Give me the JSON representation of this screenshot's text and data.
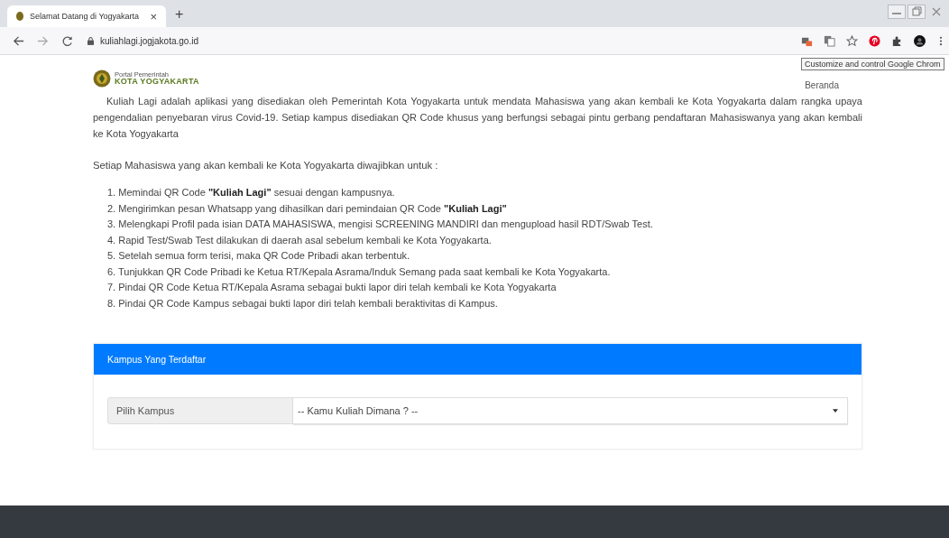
{
  "browser": {
    "tab_title": "Selamat Datang di Yogyakarta",
    "tab_close": "×",
    "new_tab": "+",
    "url": "kuliahlagi.jogjakota.go.id",
    "tooltip": "Customize and control Google Chrom"
  },
  "header": {
    "logo_top": "Portal Pemerintah",
    "logo_main": "KOTA YOGYAKARTA",
    "nav": "Beranda"
  },
  "intro": "Kuliah Lagi adalah aplikasi yang disediakan oleh Pemerintah Kota Yogyakarta untuk mendata Mahasiswa yang akan kembali ke Kota Yogyakarta dalam rangka upaya pengendalian penyebaran virus Covid-19. Setiap kampus disediakan QR Code khusus yang berfungsi sebagai pintu gerbang pendaftaran Mahasiswanya yang akan kembali ke Kota Yogyakarta",
  "lead": "Setiap Mahasiswa yang akan kembali ke Kota Yogyakarta diwajibkan untuk :",
  "steps": [
    "1. Memindai QR Code **\"Kuliah Lagi\"** sesuai dengan kampusnya.",
    "2. Mengirimkan pesan Whatsapp yang dihasilkan dari pemindaian QR Code **\"Kuliah Lagi\"**",
    "3. Melengkapi Profil pada isian DATA MAHASISWA, mengisi SCREENING MANDIRI dan mengupload hasil RDT/Swab Test.",
    "4. Rapid Test/Swab Test dilakukan di daerah asal sebelum kembali ke Kota Yogyakarta.",
    "5. Setelah semua form terisi, maka QR Code Pribadi akan terbentuk.",
    "6. Tunjukkan QR Code Pribadi ke Ketua RT/Kepala Asrama/Induk Semang pada saat kembali ke Kota Yogyakarta.",
    "7. Pindai QR Code Ketua RT/Kepala Asrama sebagai bukti lapor diri telah kembali ke Kota Yogyakarta",
    "8. Pindai QR Code Kampus sebagai bukti lapor diri telah kembali beraktivitas di Kampus."
  ],
  "card": {
    "title": "Kampus Yang Terdaftar",
    "field_label": "Pilih Kampus",
    "select_value": "-- Kamu Kuliah Dimana ? --"
  }
}
